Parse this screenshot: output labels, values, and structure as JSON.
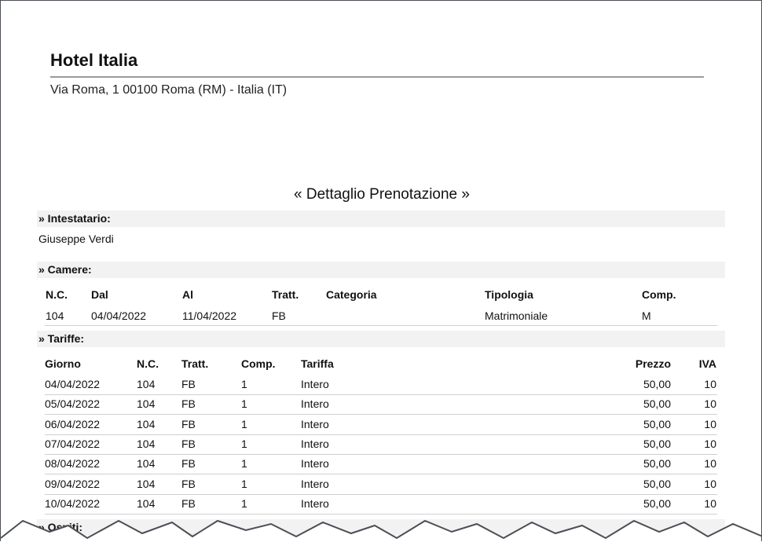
{
  "hotel": {
    "name": "Hotel Italia",
    "address": "Via Roma, 1 00100 Roma (RM) - Italia (IT)"
  },
  "document": {
    "title": "« Dettaglio Prenotazione »"
  },
  "intestatario": {
    "heading": "» Intestatario:",
    "name": "Giuseppe Verdi"
  },
  "camere": {
    "heading": "» Camere:",
    "columns": [
      "N.C.",
      "Dal",
      "Al",
      "Tratt.",
      "Categoria",
      "Tipologia",
      "Comp."
    ],
    "rows": [
      [
        "104",
        "04/04/2022",
        "11/04/2022",
        "FB",
        "",
        "Matrimoniale",
        "M"
      ]
    ]
  },
  "tariffe": {
    "heading": "» Tariffe:",
    "columns": [
      "Giorno",
      "N.C.",
      "Tratt.",
      "Comp.",
      "Tariffa",
      "Prezzo",
      "IVA"
    ],
    "rows": [
      [
        "04/04/2022",
        "104",
        "FB",
        "1",
        "Intero",
        "50,00",
        "10"
      ],
      [
        "05/04/2022",
        "104",
        "FB",
        "1",
        "Intero",
        "50,00",
        "10"
      ],
      [
        "06/04/2022",
        "104",
        "FB",
        "1",
        "Intero",
        "50,00",
        "10"
      ],
      [
        "07/04/2022",
        "104",
        "FB",
        "1",
        "Intero",
        "50,00",
        "10"
      ],
      [
        "08/04/2022",
        "104",
        "FB",
        "1",
        "Intero",
        "50,00",
        "10"
      ],
      [
        "09/04/2022",
        "104",
        "FB",
        "1",
        "Intero",
        "50,00",
        "10"
      ],
      [
        "10/04/2022",
        "104",
        "FB",
        "1",
        "Intero",
        "50,00",
        "10"
      ]
    ]
  },
  "ospiti": {
    "heading": "» Ospiti:"
  },
  "colors": {
    "section_background": "#f2f2f2",
    "rule": "#9a9a9a",
    "frame": "#4b4f55"
  }
}
